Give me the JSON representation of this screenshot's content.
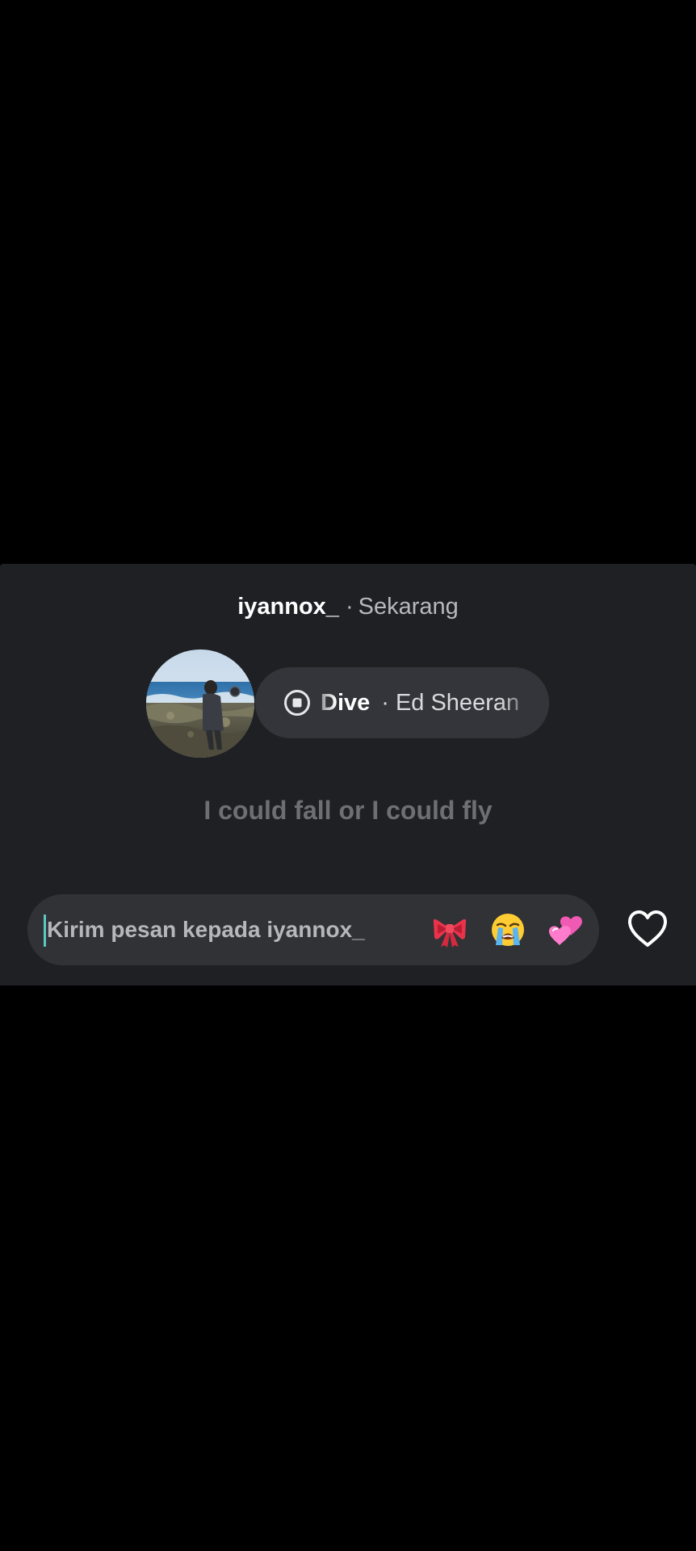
{
  "story_reply": {
    "username": "iyannox_",
    "separator": "·",
    "time": "Sekarang",
    "music": {
      "song": "Dive",
      "separator": "·",
      "artist": "Ed Sheeran",
      "icon": "stop-circle-icon"
    },
    "lyrics": "I could fall or I could fly",
    "composer": {
      "placeholder": "Kirim pesan kepada iyannox_",
      "value": "",
      "quick_reactions": [
        {
          "name": "ribbon-emoji",
          "label": "🎀"
        },
        {
          "name": "loudly-crying-face-emoji",
          "label": "😭"
        },
        {
          "name": "two-hearts-emoji",
          "label": "💞"
        }
      ],
      "like_icon": "heart-outline-icon"
    }
  },
  "colors": {
    "page_background": "#000000",
    "sheet_background": "#1f2023",
    "pill_background": "#33353a",
    "composer_background": "#303236",
    "muted_text": "#b8b9bd",
    "lyrics_text": "#6d6f73",
    "caret": "#5fc7c2"
  }
}
